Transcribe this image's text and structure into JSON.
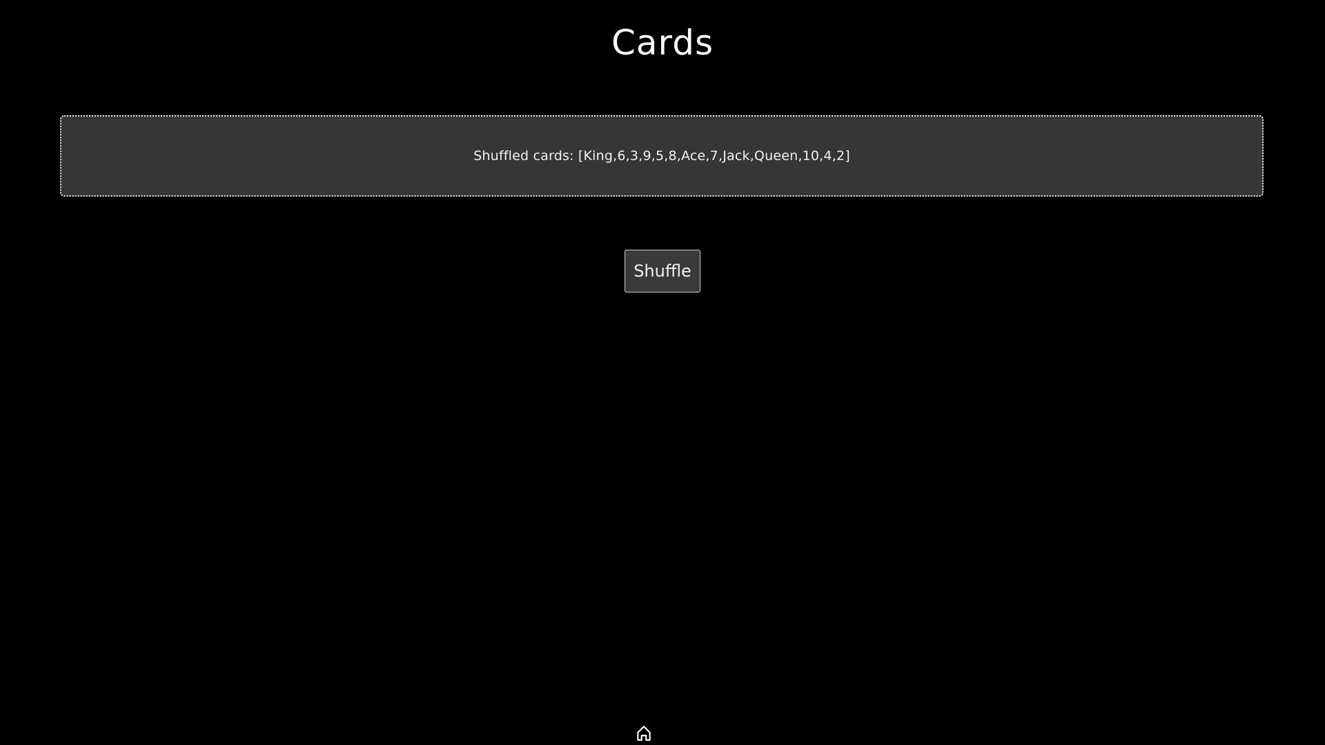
{
  "page": {
    "title": "Cards"
  },
  "cards_panel": {
    "text": "Shuffled cards: [King,6,3,9,5,8,Ace,7,Jack,Queen,10,4,2]"
  },
  "controls": {
    "shuffle_label": "Shuffle"
  },
  "footer": {
    "home_icon": "home-icon"
  },
  "colors": {
    "background": "#000000",
    "panel": "#363636",
    "text": "#ffffff",
    "button": "#3a3a3a"
  }
}
